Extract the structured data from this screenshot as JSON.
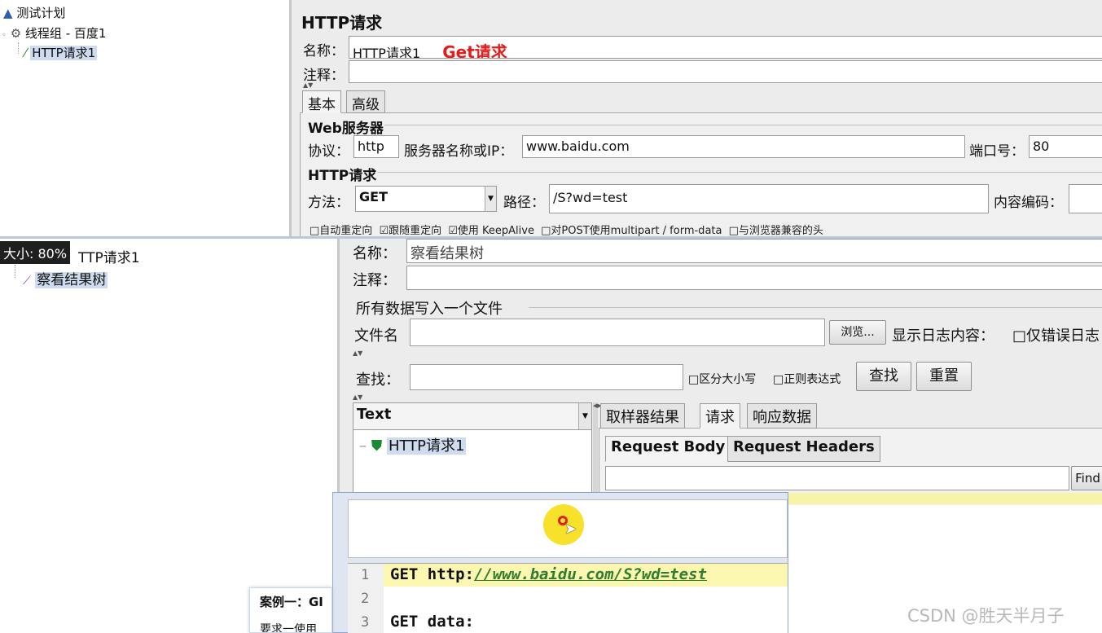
{
  "top": {
    "tree": {
      "test_plan": "测试计划",
      "thread_group": "线程组 - 百度1",
      "http_request": "HTTP请求1"
    },
    "panel": {
      "title": "HTTP请求",
      "name_label": "名称：",
      "name_value": "HTTP请求1",
      "annotation": "Get请求",
      "comment_label": "注释：",
      "tabs": [
        "基本",
        "高级"
      ],
      "web_server_section": "Web服务器",
      "protocol_label": "协议：",
      "protocol_value": "http",
      "server_label": "服务器名称或IP：",
      "server_value": "www.baidu.com",
      "port_label": "端口号：",
      "port_value": "80",
      "http_section": "HTTP请求",
      "method_label": "方法：",
      "method_value": "GET",
      "path_label": "路径：",
      "path_value": "/S?wd=test",
      "encoding_label": "内容编码：",
      "checkboxes": [
        "□自动重定向",
        "☑跟随重定向",
        "☑使用 KeepAlive",
        "□对POST使用multipart / form-data",
        "□与浏览器兼容的头"
      ]
    }
  },
  "bottom": {
    "size_badge": "大小: 80%",
    "tree": {
      "http_request": "TTP请求1",
      "result_tree": "察看结果树"
    },
    "panel": {
      "name_label": "名称：",
      "name_value": "察看结果树",
      "comment_label": "注释：",
      "file_section": "所有数据写入一个文件",
      "filename_label": "文件名",
      "browse_button": "浏览...",
      "log_label": "显示日志内容：",
      "errors_only": "□仅错误日志",
      "search_label": "查找：",
      "case_checkbox": "□区分大小写",
      "regex_checkbox": "□正则表达式",
      "find_button": "查找",
      "reset_button": "重置",
      "renderer_value": "Text",
      "result_item": "HTTP请求1",
      "result_tabs": [
        "取样器结果",
        "请求",
        "响应数据"
      ],
      "sub_tabs": [
        "Request Body",
        "Request Headers"
      ],
      "find_small": "Find"
    },
    "code": {
      "lines": [
        {
          "num": "1",
          "prefix": "GET http:",
          "url": "//www.baidu.com/S?wd=test"
        },
        {
          "num": "2",
          "prefix": "",
          "url": ""
        },
        {
          "num": "3",
          "prefix": "GET data:",
          "url": ""
        }
      ]
    },
    "tooltip": {
      "title": "案例一：GI",
      "second": "要求一使用"
    },
    "watermark": "CSDN @胜天半月子"
  }
}
